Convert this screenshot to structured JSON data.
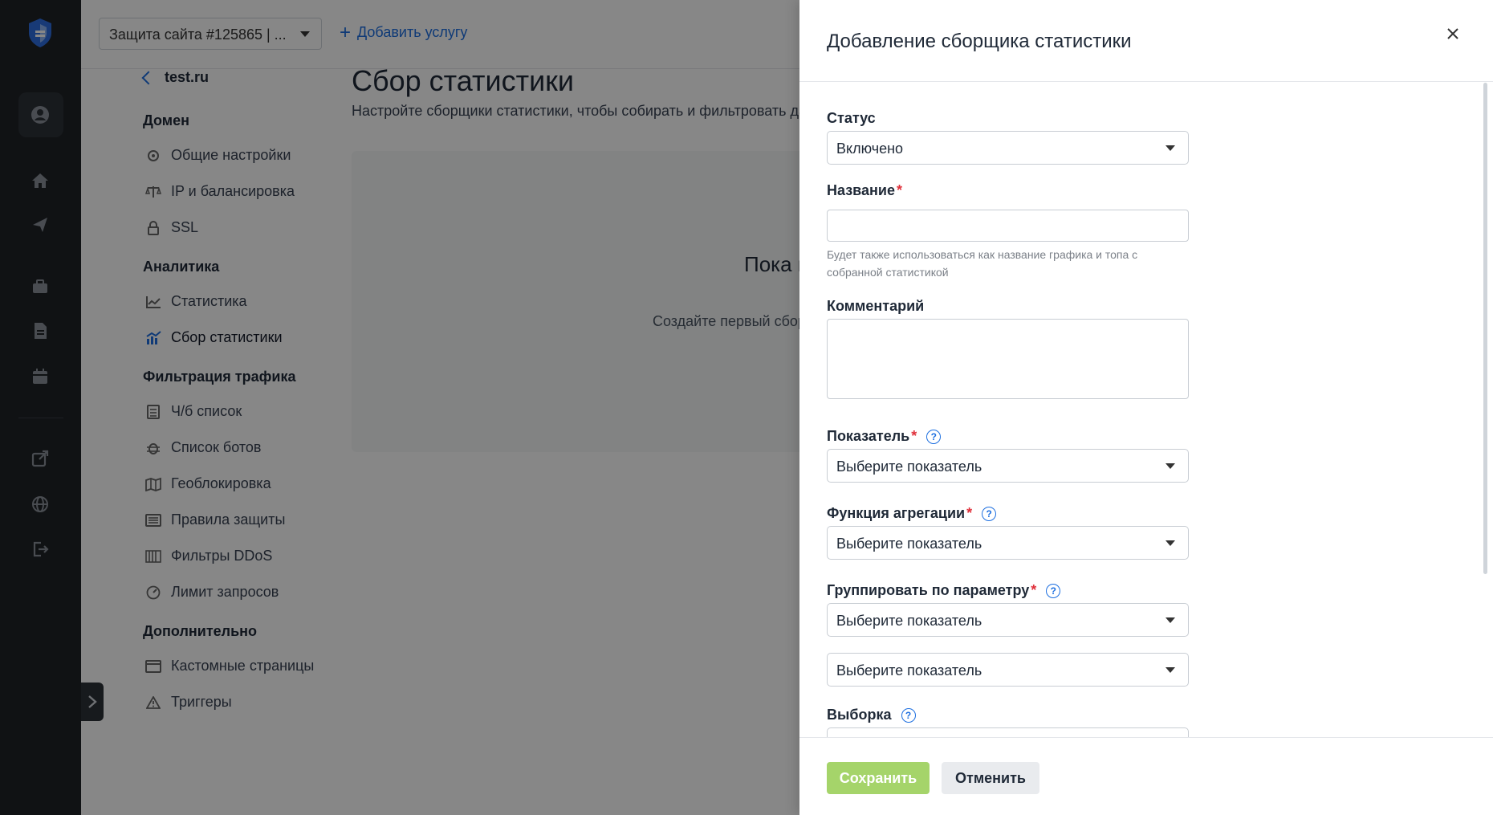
{
  "topbar": {
    "service_select": "Защита сайта #125865 | ...",
    "add_service": "Добавить услугу"
  },
  "nav": {
    "back_label": "test.ru",
    "sections": [
      {
        "title": "Домен",
        "items": [
          {
            "label": "Общие настройки",
            "icon": "gear-icon"
          },
          {
            "label": "IP и балансировка",
            "icon": "scales-icon"
          },
          {
            "label": "SSL",
            "icon": "lock-icon"
          }
        ]
      },
      {
        "title": "Аналитика",
        "items": [
          {
            "label": "Статистика",
            "icon": "chart-icon"
          },
          {
            "label": "Сбор статистики",
            "icon": "chart-collect-icon"
          }
        ]
      },
      {
        "title": "Фильтрация трафика",
        "items": [
          {
            "label": "Ч/б список",
            "icon": "list-icon"
          },
          {
            "label": "Список ботов",
            "icon": "bug-icon"
          },
          {
            "label": "Геоблокировка",
            "icon": "map-icon"
          },
          {
            "label": "Правила защиты",
            "icon": "rules-icon"
          },
          {
            "label": "Фильтры DDoS",
            "icon": "filter-icon"
          },
          {
            "label": "Лимит запросов",
            "icon": "speed-icon"
          }
        ]
      },
      {
        "title": "Дополнительно",
        "items": [
          {
            "label": "Кастомные страницы",
            "icon": "window-icon"
          },
          {
            "label": "Триггеры",
            "icon": "warning-icon"
          }
        ]
      }
    ]
  },
  "page": {
    "title": "Сбор статистики",
    "subtitle": "Настройте сборщики статистики, чтобы собирать и фильтровать да",
    "empty_title": "Пока н",
    "empty_sub": "Создайте первый сбор"
  },
  "drawer": {
    "title": "Добавление сборщика статистики",
    "status_label": "Статус",
    "status_value": "Включено",
    "name_label": "Название",
    "name_hint": "Будет также использоваться как название графика и топа с собранной статистикой",
    "comment_label": "Комментарий",
    "metric_label": "Показатель",
    "metric_placeholder": "Выберите показатель",
    "agg_label": "Функция агрегации",
    "agg_placeholder": "Выберите показатель",
    "group_label": "Группировать по параметру",
    "group_placeholder_1": "Выберите показатель",
    "group_placeholder_2": "Выберите показатель",
    "sample_label": "Выборка",
    "required_mark": "*",
    "help_mark": "?",
    "save": "Сохранить",
    "cancel": "Отменить"
  }
}
